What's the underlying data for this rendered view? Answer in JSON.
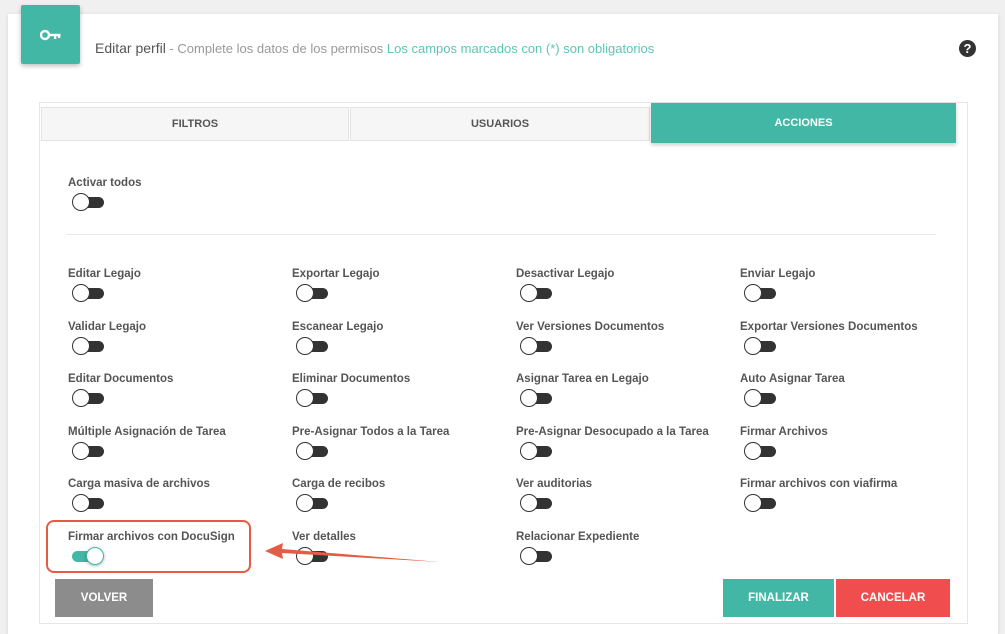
{
  "header": {
    "title": "Editar perfil",
    "separator": " - ",
    "subtitle": "Complete los datos de los permisos ",
    "required_note": "Los campos marcados con (*) son obligatorios",
    "badge_icon": "key-icon",
    "help_icon": "question-circle-icon",
    "help_glyph": "?"
  },
  "tabs": [
    {
      "label": "FILTROS",
      "active": false
    },
    {
      "label": "USUARIOS",
      "active": false
    },
    {
      "label": "ACCIONES",
      "active": true
    }
  ],
  "activar_todos": {
    "label": "Activar todos",
    "on": false
  },
  "permissions": [
    {
      "label": "Editar Legajo",
      "on": false
    },
    {
      "label": "Exportar Legajo",
      "on": false
    },
    {
      "label": "Desactivar Legajo",
      "on": false
    },
    {
      "label": "Enviar Legajo",
      "on": false
    },
    {
      "label": "Validar Legajo",
      "on": false
    },
    {
      "label": "Escanear Legajo",
      "on": false
    },
    {
      "label": "Ver Versiones Documentos",
      "on": false
    },
    {
      "label": "Exportar Versiones Documentos",
      "on": false
    },
    {
      "label": "Editar Documentos",
      "on": false
    },
    {
      "label": "Eliminar Documentos",
      "on": false
    },
    {
      "label": "Asignar Tarea en Legajo",
      "on": false
    },
    {
      "label": "Auto Asignar Tarea",
      "on": false
    },
    {
      "label": "Múltiple Asignación de Tarea",
      "on": false
    },
    {
      "label": "Pre-Asignar Todos a la Tarea",
      "on": false
    },
    {
      "label": "Pre-Asignar Desocupado a la Tarea",
      "on": false
    },
    {
      "label": "Firmar Archivos",
      "on": false
    },
    {
      "label": "Carga masiva de archivos",
      "on": false
    },
    {
      "label": "Carga de recibos",
      "on": false
    },
    {
      "label": "Ver auditorias",
      "on": false
    },
    {
      "label": "Firmar archivos con viafirma",
      "on": false
    },
    {
      "label": "Firmar archivos con DocuSign",
      "on": true
    },
    {
      "label": "Ver detalles",
      "on": false
    },
    {
      "label": "Relacionar Expediente",
      "on": false
    }
  ],
  "buttons": {
    "volver": "VOLVER",
    "finalizar": "FINALIZAR",
    "cancelar": "CANCELAR"
  },
  "colors": {
    "accent": "#43b7a6",
    "danger": "#f04e4e",
    "annotation": "#e55b45",
    "neutral_button": "#8c8c8c"
  }
}
